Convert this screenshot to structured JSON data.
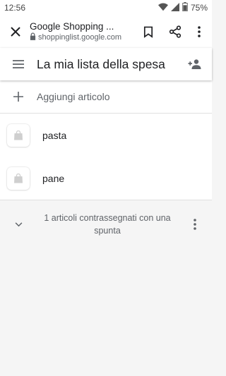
{
  "status_bar": {
    "time": "12:56",
    "battery": "75%"
  },
  "browser": {
    "page_title": "Google Shopping ...",
    "url": "shoppinglist.google.com"
  },
  "app_bar": {
    "title": "La mia lista della spesa"
  },
  "add_item": {
    "label": "Aggiungi articolo"
  },
  "items": [
    {
      "name": "pasta"
    },
    {
      "name": "pane"
    }
  ],
  "checked_section": {
    "text": "1 articoli contrassegnati con una spunta"
  }
}
